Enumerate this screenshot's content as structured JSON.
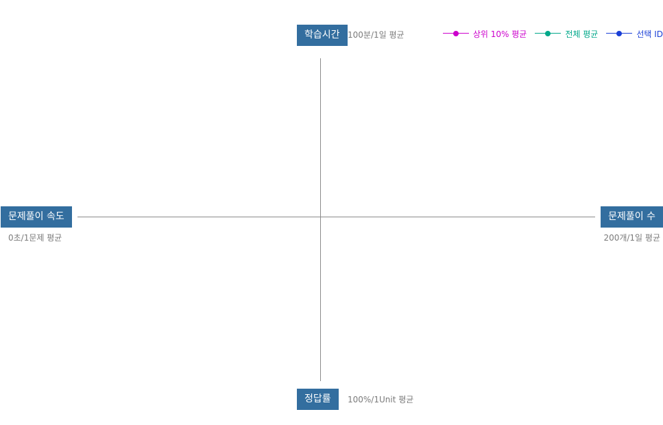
{
  "chart_data": {
    "type": "radar",
    "axes": [
      {
        "key": "top",
        "label": "학습시간",
        "note": "100분/1일 평균"
      },
      {
        "key": "right",
        "label": "문제풀이 수",
        "note": "200개/1일 평균"
      },
      {
        "key": "bottom",
        "label": "정답률",
        "note": "100%/1Unit 평균"
      },
      {
        "key": "left",
        "label": "문제풀이 속도",
        "note": "0초/1문제 평균"
      }
    ],
    "series": [
      {
        "name": "상위 10% 평균",
        "color": "#cc00cc",
        "values": []
      },
      {
        "name": "전체 평균",
        "color": "#00a88a",
        "values": []
      },
      {
        "name": "선택 ID",
        "color": "#1a3fd6",
        "values": []
      }
    ],
    "axis_color": "#8a8a8a",
    "label_bg": "#336e9f",
    "legend_position": "top-right"
  }
}
